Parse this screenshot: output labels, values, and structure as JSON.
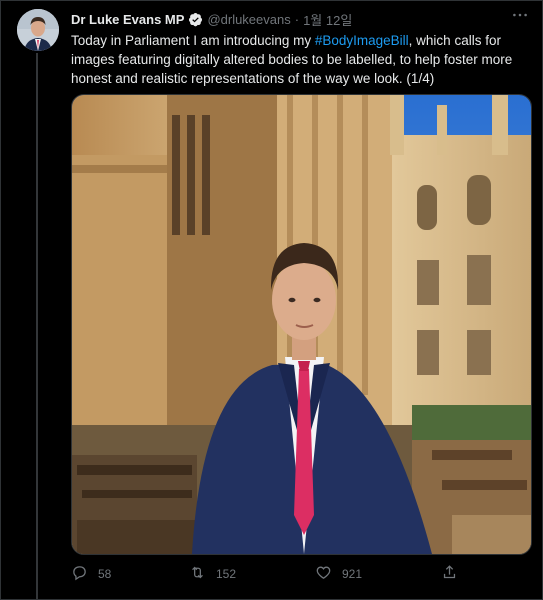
{
  "tweet": {
    "author_name": "Dr Luke Evans MP",
    "handle": "@drlukeevans",
    "separator": "·",
    "date": "1월 12일",
    "text_before": "Today in Parliament I am introducing my ",
    "hashtag": "#BodyImageBill",
    "text_after": ", which calls for images featuring digitally altered bodies to be labelled, to help foster more honest and realistic representations of the way we look. (1/4)",
    "more_icon": "more-horizontal-icon",
    "verified_icon": "verified-badge-icon"
  },
  "actions": {
    "reply_count": "58",
    "retweet_count": "152",
    "like_count": "921",
    "reply_icon": "reply-icon",
    "retweet_icon": "retweet-icon",
    "like_icon": "heart-icon",
    "share_icon": "share-icon"
  },
  "colors": {
    "background": "#000000",
    "text": "#e7e9ea",
    "secondary": "#71767b",
    "accent": "#1d9bf0"
  }
}
